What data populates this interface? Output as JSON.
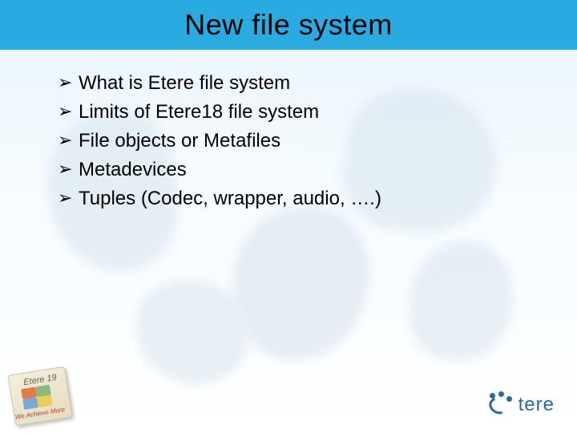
{
  "title": "New file system",
  "bullets": [
    "What is Etere file system",
    "Limits of Etere18 file system",
    "File objects or Metafiles",
    "Metadevices",
    "Tuples (Codec, wrapper, audio, ….)"
  ],
  "badge": {
    "line1": "Etere 19",
    "line2": "We Achieve More"
  },
  "logo": {
    "text": "tere"
  }
}
